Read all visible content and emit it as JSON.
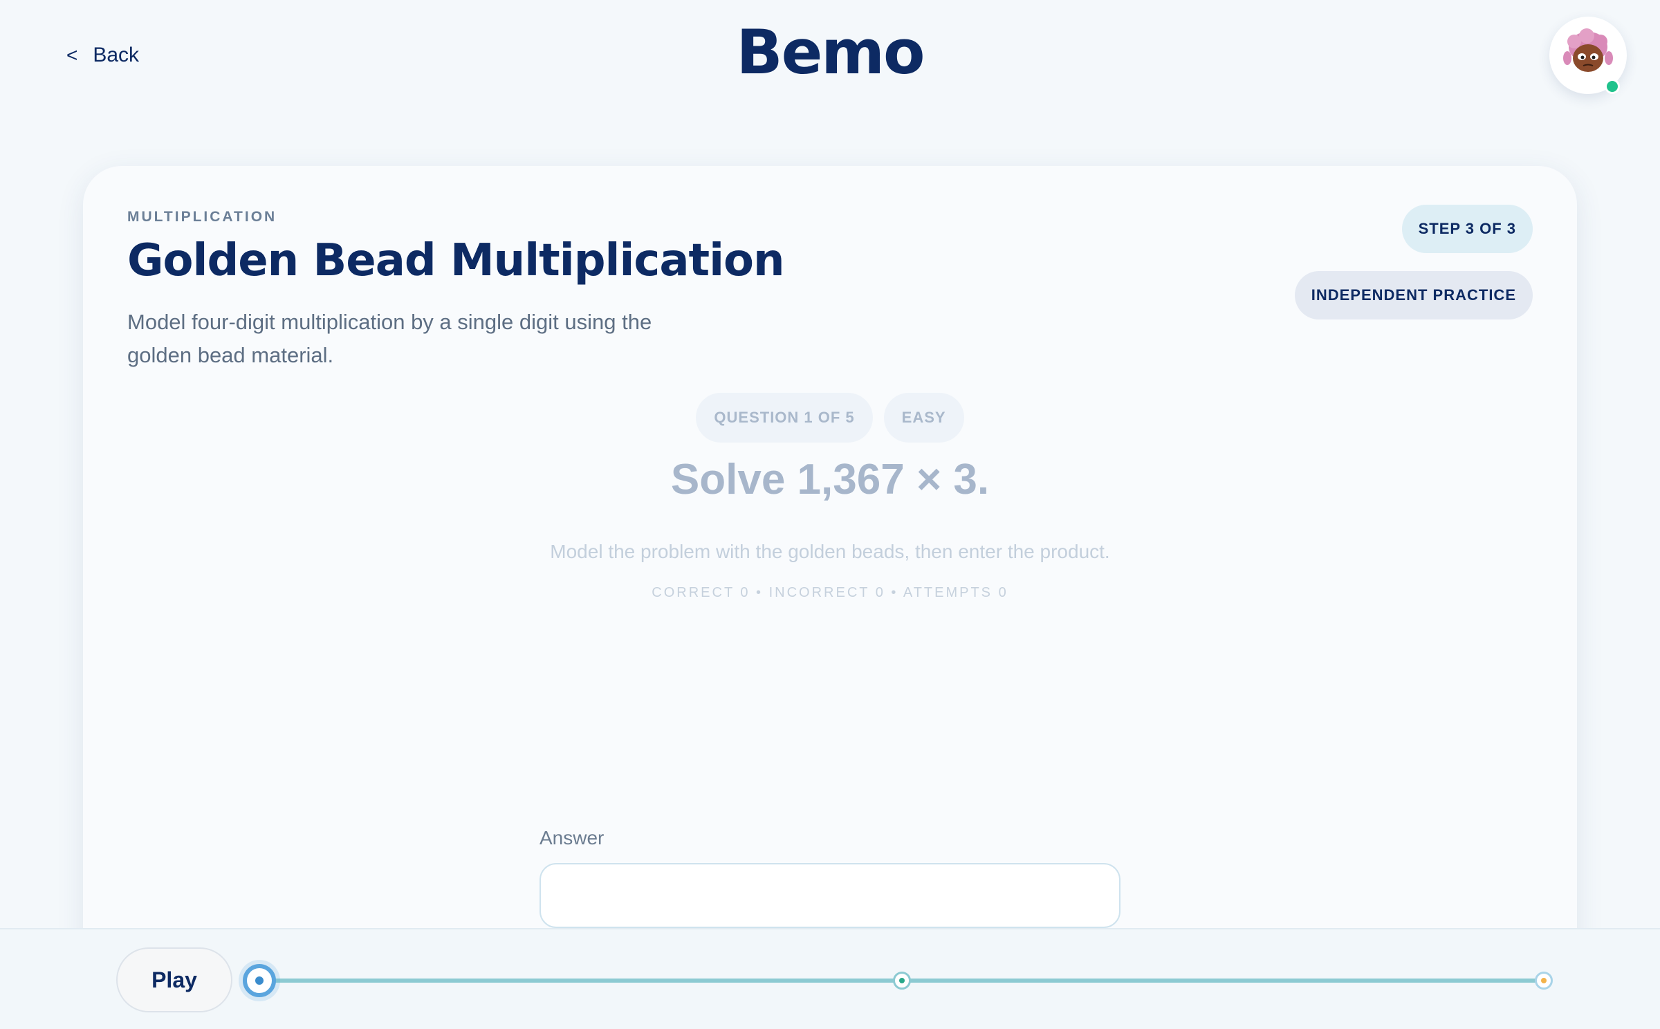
{
  "header": {
    "back_label": "Back",
    "back_chevron": "<",
    "brand": "Bemo",
    "avatar_icon": "kid-avatar-icon",
    "status_color": "#1fc28c"
  },
  "lesson": {
    "category": "MULTIPLICATION",
    "title": "Golden Bead Multiplication",
    "description": "Model four-digit multiplication by a single digit using the golden bead material.",
    "step_badge": "STEP 3 OF 3",
    "mode_badge": "INDEPENDENT PRACTICE"
  },
  "question": {
    "counter": "QUESTION 1 OF 5",
    "difficulty": "EASY",
    "prompt": "Solve 1,367 × 3.",
    "hint": "Model the problem with the golden beads, then enter the product.",
    "stats": "CORRECT 0 • INCORRECT 0 • ATTEMPTS 0"
  },
  "answer": {
    "label": "Answer",
    "value": "",
    "placeholder": ""
  },
  "player": {
    "play_label": "Play",
    "milestones": 3,
    "current_milestone": 1,
    "colors": {
      "track": "#8ccad2",
      "active": "#5aa5de",
      "done": "#29a88a",
      "final": "#f3b34a"
    }
  }
}
